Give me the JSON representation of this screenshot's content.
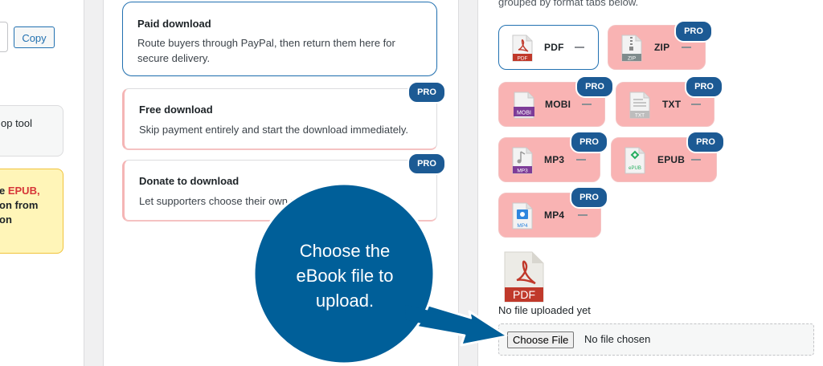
{
  "left": {
    "copy_label": "Copy",
    "tool_card_text": "op tool",
    "notice": {
      "line1_prefix": "e ",
      "line1_highlight": "EPUB,",
      "line2": "on from",
      "line3": "on"
    }
  },
  "options": [
    {
      "title": "Paid download",
      "desc_line1": "Route buyers through PayPal, then return them here for",
      "desc_line2": "secure delivery.",
      "selected": true,
      "pro": false
    },
    {
      "title": "Free download",
      "desc_line1": "Skip payment entirely and start the download immediately.",
      "desc_line2": "",
      "selected": false,
      "pro": true
    },
    {
      "title": "Donate to download",
      "desc_line1": "Let supporters choose their own p",
      "desc_line2": "",
      "selected": false,
      "pro": true
    }
  ],
  "pro_label": "PRO",
  "formats": {
    "intro": "grouped by format tabs below.",
    "tabs": [
      {
        "label": "PDF",
        "icon": "pdf-icon",
        "tag": "PDF",
        "state": "active"
      },
      {
        "label": "ZIP",
        "icon": "zip-icon",
        "tag": "ZIP",
        "state": "locked"
      },
      {
        "label": "MOBI",
        "icon": "mobi-icon",
        "tag": "MOBI",
        "state": "locked"
      },
      {
        "label": "TXT",
        "icon": "txt-icon",
        "tag": "TXT",
        "state": "locked"
      },
      {
        "label": "MP3",
        "icon": "mp3-icon",
        "tag": "MP3",
        "state": "locked"
      },
      {
        "label": "EPUB",
        "icon": "epub-icon",
        "tag": "ePUB",
        "state": "locked"
      },
      {
        "label": "MP4",
        "icon": "mp4-icon",
        "tag": "MP4",
        "state": "locked"
      }
    ]
  },
  "upload": {
    "preview_tag": "PDF",
    "status": "No file uploaded yet",
    "button_label": "Choose File",
    "chosen_text": "No file chosen"
  },
  "callout": {
    "line1": "Choose the",
    "line2": "eBook file to",
    "line3": "upload.",
    "color": "#005f99"
  },
  "colors": {
    "accent": "#2271b1",
    "pro_badge": "#1c5a94",
    "locked_tab": "#f9b3b3",
    "pdf_red": "#c0392b"
  }
}
